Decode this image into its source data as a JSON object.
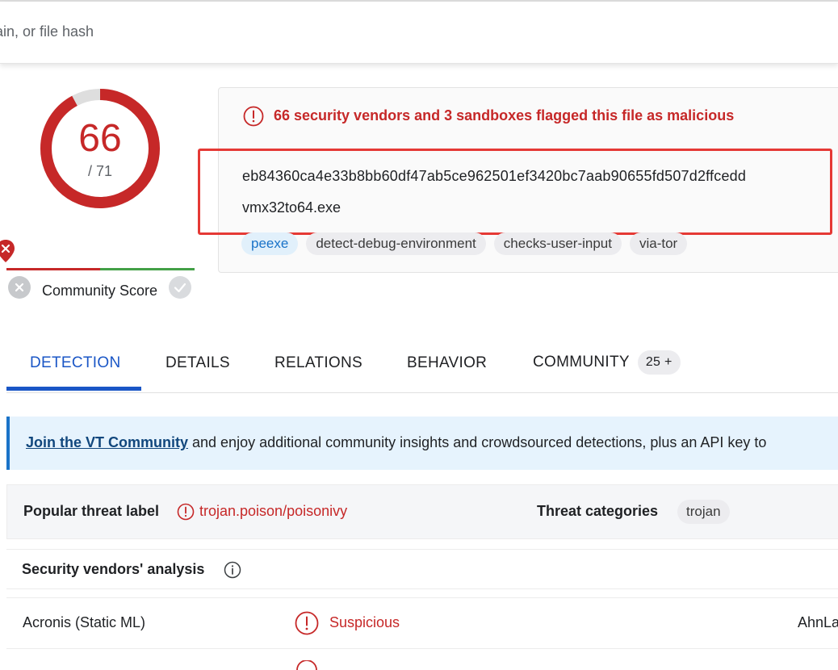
{
  "search": {
    "placeholder": "ain, or file hash"
  },
  "score": {
    "detections": "66",
    "total": "/ 71",
    "color": "#c62828"
  },
  "community": {
    "label": "Community Score"
  },
  "summary": {
    "alert": "66 security vendors and 3 sandboxes flagged this file as malicious",
    "hash": "eb84360ca4e33b8bb60df47ab5ce962501ef3420bc7aab90655fd507d2ffcedd",
    "filename": "vmx32to64.exe",
    "tags": [
      "peexe",
      "detect-debug-environment",
      "checks-user-input",
      "via-tor"
    ]
  },
  "tabs": [
    {
      "label": "DETECTION"
    },
    {
      "label": "DETAILS"
    },
    {
      "label": "RELATIONS"
    },
    {
      "label": "BEHAVIOR"
    },
    {
      "label": "COMMUNITY",
      "badge": "25 +"
    }
  ],
  "banner": {
    "link": "Join the VT Community",
    "text": " and enjoy additional community insights and crowdsourced detections, plus an API key to"
  },
  "threat": {
    "label": "Popular threat label",
    "value": "trojan.poison/poisonivy",
    "categories_label": "Threat categories",
    "category": "trojan"
  },
  "vendors": {
    "section_label": "Security vendors' analysis",
    "rows": [
      {
        "name": "Acronis (Static ML)",
        "result": "Suspicious",
        "next_vendor": "AhnLa"
      }
    ]
  },
  "icons": {
    "alert": "alert-circle-icon",
    "info": "info-icon",
    "pin": "map-pin-x-icon",
    "thumb_down": "x-circle-icon",
    "thumb_up": "check-circle-icon"
  },
  "colors": {
    "malicious": "#c62828",
    "accent": "#1a56c6",
    "highlight_box": "#e53935"
  }
}
